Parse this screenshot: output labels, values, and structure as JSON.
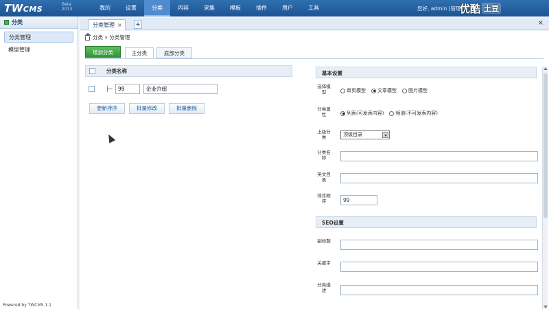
{
  "app": {
    "logo": "TWCMS",
    "logo_main": "TW",
    "logo_cms": "CMS",
    "version": "Beta",
    "year": "2013",
    "greeting": "您好, admin (管理",
    "watermark_youku": "优酷",
    "watermark_tudou": "土豆"
  },
  "nav": {
    "items": [
      {
        "label": "我的"
      },
      {
        "label": "设置"
      },
      {
        "label": "分类"
      },
      {
        "label": "内容"
      },
      {
        "label": "采集"
      },
      {
        "label": "模板"
      },
      {
        "label": "插件"
      },
      {
        "label": "用户"
      },
      {
        "label": "工具"
      }
    ],
    "active_index": 2
  },
  "sidebar": {
    "title": "分类",
    "items": [
      {
        "label": "分类管理"
      },
      {
        "label": "模型管理"
      }
    ],
    "powered": "Powered by TWCMS 1.1"
  },
  "tabs": {
    "page_tab": "分类管理",
    "close_glyph": "×",
    "add_glyph": "+",
    "window_close_glyph": "×"
  },
  "breadcrumb": {
    "text": "分类 » 分类管理"
  },
  "toolbar": {
    "add_button": "增加分类",
    "subtabs": [
      {
        "label": "主分类"
      },
      {
        "label": "底部分类"
      }
    ]
  },
  "table": {
    "header_name": "分类名称",
    "rows": [
      {
        "tree": "├─",
        "order": "99",
        "name": "企业介绍"
      }
    ],
    "actions": [
      {
        "label": "更新排序"
      },
      {
        "label": "批量修改"
      },
      {
        "label": "批量删除"
      }
    ]
  },
  "form": {
    "basic_title": "基本设置",
    "seo_title": "SEO设置",
    "model_label": "选择模型",
    "model_options": [
      {
        "label": "单页模型",
        "checked": false
      },
      {
        "label": "文章模型",
        "checked": true
      },
      {
        "label": "图片模型",
        "checked": false
      }
    ],
    "attr_label": "分类属性",
    "attr_options": [
      {
        "label": "列表(可发表内容)",
        "checked": true
      },
      {
        "label": "频道(不可发表内容)",
        "checked": false
      }
    ],
    "parent_label": "上级分类",
    "parent_value": "顶级目录",
    "name_label": "分类名称",
    "name_value": "",
    "alias_label": "英文目录",
    "alias_value": "",
    "order_label": "排序顺序",
    "order_value": "99",
    "subtitle_label": "副标题",
    "subtitle_value": "",
    "keywords_label": "关键字",
    "keywords_value": "",
    "desc_label": "分类描述",
    "desc_value": ""
  }
}
